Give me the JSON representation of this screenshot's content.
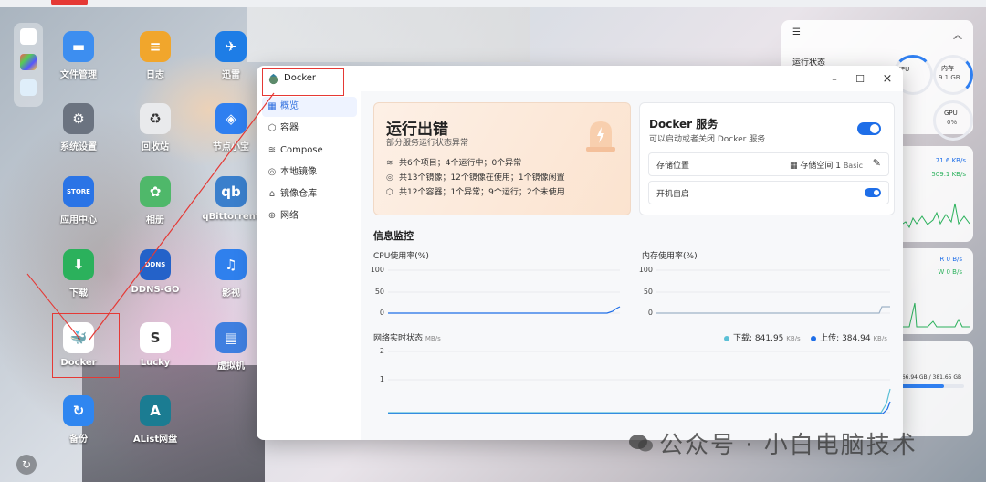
{
  "desktop": {
    "icons": [
      {
        "label": "文件管理",
        "color": "#3d8ef0",
        "glyph": "▬",
        "icon": "folder-icon"
      },
      {
        "label": "日志",
        "color": "#f1a62c",
        "glyph": "≡",
        "icon": "log-icon"
      },
      {
        "label": "迅雷",
        "color": "#1e7de6",
        "glyph": "✈",
        "icon": "thunder-icon"
      },
      {
        "label": "系统设置",
        "color": "#6b7380",
        "glyph": "⚙",
        "icon": "settings-icon"
      },
      {
        "label": "回收站",
        "color": "#e9eaec",
        "glyph": "♻",
        "icon": "recycle-bin-icon"
      },
      {
        "label": "节点小宝",
        "color": "#2f7ff0",
        "glyph": "◈",
        "icon": "node-icon"
      },
      {
        "label": "应用中心",
        "color": "#2a74e6",
        "glyph": "STORE",
        "icon": "store-icon"
      },
      {
        "label": "相册",
        "color": "#4fb86a",
        "glyph": "✿",
        "icon": "album-icon"
      },
      {
        "label": "qBittorrent",
        "color": "#3a7fcc",
        "glyph": "qb",
        "icon": "qbittorrent-icon"
      },
      {
        "label": "下载",
        "color": "#2bb15c",
        "glyph": "⬇",
        "icon": "download-icon"
      },
      {
        "label": "DDNS-GO",
        "color": "#2462c9",
        "glyph": "DDNS",
        "icon": "ddns-icon"
      },
      {
        "label": "影视",
        "color": "#2f80ed",
        "glyph": "♫",
        "icon": "video-icon"
      },
      {
        "label": "Docker",
        "color": "#ffffff",
        "glyph": "🐳",
        "icon": "docker-icon"
      },
      {
        "label": "Lucky",
        "color": "#ffffff",
        "glyph": "S",
        "icon": "lucky-icon"
      },
      {
        "label": "虚拟机",
        "color": "#3f7fe0",
        "glyph": "▤",
        "icon": "vm-icon"
      },
      {
        "label": "备份",
        "color": "#2f86f0",
        "glyph": "↻",
        "icon": "backup-icon"
      },
      {
        "label": "AList网盘",
        "color": "#1b7c92",
        "glyph": "A",
        "icon": "alist-icon"
      }
    ]
  },
  "widgets": {
    "status_title": "运行状态",
    "cpu_label": "CPU",
    "mem_label": "内存",
    "mem_value": "9.1 GB",
    "gpu_label": "GPU",
    "gpu_value": "0%",
    "net_up": "71.6 KB/s",
    "net_down": "509.1 KB/s",
    "disk_read": "R 0 B/s",
    "disk_write": "W 0 B/s",
    "storage": "266.94 GB / 381.65 GB"
  },
  "window": {
    "title": "Docker",
    "buttons": {
      "minimize": "–",
      "maximize": "☐",
      "close": "×"
    },
    "nav": [
      {
        "label": "概览",
        "icon": "grid-icon",
        "glyph": "▦",
        "active": true
      },
      {
        "label": "容器",
        "icon": "box-icon",
        "glyph": "⬡",
        "active": false
      },
      {
        "label": "Compose",
        "icon": "layers-icon",
        "glyph": "≋",
        "active": false
      },
      {
        "label": "本地镜像",
        "icon": "disc-icon",
        "glyph": "◎",
        "active": false
      },
      {
        "label": "镜像仓库",
        "icon": "home-icon",
        "glyph": "⌂",
        "active": false
      },
      {
        "label": "网络",
        "icon": "globe-icon",
        "glyph": "⊕",
        "active": false
      }
    ],
    "error_card": {
      "title": "运行出错",
      "subtitle": "部分服务运行状态异常",
      "lines": [
        {
          "icon": "layers-icon",
          "glyph": "≋",
          "text": "共6个项目；4个运行中；0个异常"
        },
        {
          "icon": "disc-icon",
          "glyph": "◎",
          "text": "共13个镜像；12个镜像在使用；1个镜像闲置"
        },
        {
          "icon": "box-icon",
          "glyph": "⬡",
          "text": "共12个容器；1个异常；9个运行；2个未使用"
        }
      ]
    },
    "service_card": {
      "title": "Docker 服务",
      "subtitle": "可以启动或者关闭 Docker 服务",
      "storage_label": "存储位置",
      "storage_value": "存储空间 1",
      "storage_type": "Basic",
      "autostart_label": "开机自启"
    },
    "monitor": {
      "title": "信息监控",
      "cpu_title": "CPU使用率(%)",
      "mem_title": "内存使用率(%)",
      "net_title": "网络实时状态",
      "net_unit": "MB/s",
      "download_label": "下载:",
      "download_value": "841.95",
      "download_unit": "KB/s",
      "upload_label": "上传:",
      "upload_value": "384.94",
      "upload_unit": "KB/s",
      "pct_ticks": [
        "100",
        "50",
        "0"
      ],
      "net_ticks": [
        "2",
        "1"
      ],
      "colors": {
        "download": "#5bc0d6",
        "upload": "#1e6ee8"
      }
    }
  },
  "watermark": "公众号 · 小白电脑技术"
}
